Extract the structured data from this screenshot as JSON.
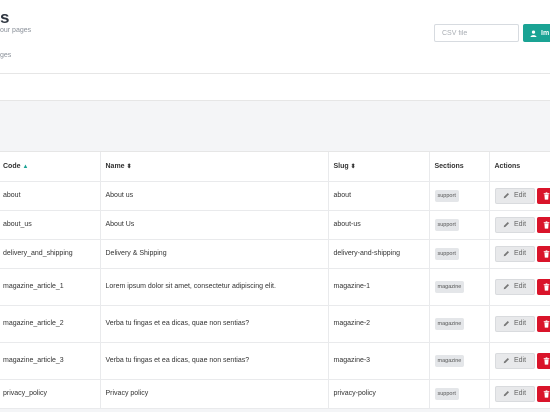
{
  "header": {
    "title": "s",
    "subtitle": "our pages",
    "crumb": "ges",
    "csv_placeholder": "CSV file",
    "import_label": "Im"
  },
  "table": {
    "columns": [
      {
        "label": "Code",
        "sort": "▲"
      },
      {
        "label": "Name",
        "sort": "⬍"
      },
      {
        "label": "Slug",
        "sort": "⬍"
      },
      {
        "label": "Sections",
        "sort": ""
      },
      {
        "label": "Actions",
        "sort": ""
      }
    ],
    "rows": [
      {
        "code": "about",
        "name": "About us",
        "slug": "about",
        "section": "support"
      },
      {
        "code": "about_us",
        "name": "About Us",
        "slug": "about-us",
        "section": "support"
      },
      {
        "code": "delivery_and_shipping",
        "name": "Delivery & Shipping",
        "slug": "delivery-and-shipping",
        "section": "support"
      },
      {
        "code": "magazine_article_1",
        "name": "Lorem ipsum dolor sit amet, consectetur adipiscing elit.",
        "slug": "magazine-1",
        "section": "magazine"
      },
      {
        "code": "magazine_article_2",
        "name": "Verba tu fingas et ea dicas, quae non sentias?",
        "slug": "magazine-2",
        "section": "magazine"
      },
      {
        "code": "magazine_article_3",
        "name": "Verba tu fingas et ea dicas, quae non sentias?",
        "slug": "magazine-3",
        "section": "magazine"
      },
      {
        "code": "privacy_policy",
        "name": "Privacy policy",
        "slug": "privacy-policy",
        "section": "support"
      }
    ],
    "edit_label": "Edit"
  },
  "colors": {
    "accent": "#1aa394",
    "danger": "#d9142a"
  },
  "icons": {
    "edit": "pencil-icon",
    "delete": "trash-icon",
    "import": "user-icon"
  }
}
